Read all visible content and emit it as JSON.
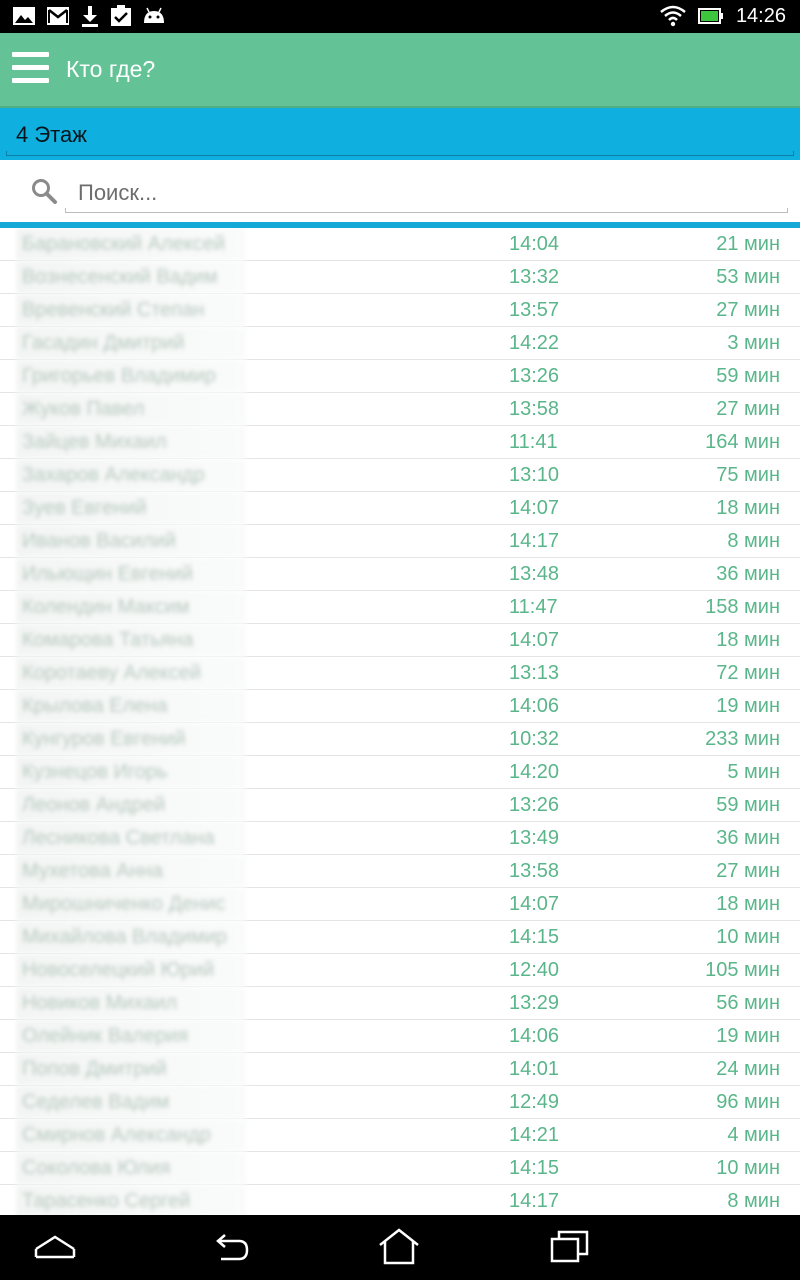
{
  "status_bar": {
    "time": "14:26"
  },
  "app_bar": {
    "title": "Кто где?"
  },
  "floor": {
    "label": "4 Этаж"
  },
  "search": {
    "placeholder": "Поиск..."
  },
  "rows": [
    {
      "name": "Барановский Алексей",
      "time": "14:04",
      "duration": "21 мин"
    },
    {
      "name": "Вознесенский Вадим",
      "time": "13:32",
      "duration": "53 мин"
    },
    {
      "name": "Вревенский Степан",
      "time": "13:57",
      "duration": "27 мин"
    },
    {
      "name": "Гасадин Дмитрий",
      "time": "14:22",
      "duration": "3 мин"
    },
    {
      "name": "Григорьев Владимир",
      "time": "13:26",
      "duration": "59 мин"
    },
    {
      "name": "Жуков Павел",
      "time": "13:58",
      "duration": "27 мин"
    },
    {
      "name": "Зайцев Михаил",
      "time": "11:41",
      "duration": "164 мин"
    },
    {
      "name": "Захаров Александр",
      "time": "13:10",
      "duration": "75 мин"
    },
    {
      "name": "Зуев Евгений",
      "time": "14:07",
      "duration": "18 мин"
    },
    {
      "name": "Иванов Василий",
      "time": "14:17",
      "duration": "8 мин"
    },
    {
      "name": "Ильющин Евгений",
      "time": "13:48",
      "duration": "36 мин"
    },
    {
      "name": "Колендин Максим",
      "time": "11:47",
      "duration": "158 мин"
    },
    {
      "name": "Комарова Татьяна",
      "time": "14:07",
      "duration": "18 мин"
    },
    {
      "name": "Коротаеву Алексей",
      "time": "13:13",
      "duration": "72 мин"
    },
    {
      "name": "Крылова Елена",
      "time": "14:06",
      "duration": "19 мин"
    },
    {
      "name": "Кунгуров Евгений",
      "time": "10:32",
      "duration": "233 мин"
    },
    {
      "name": "Кузнецов Игорь",
      "time": "14:20",
      "duration": "5 мин"
    },
    {
      "name": "Леонов Андрей",
      "time": "13:26",
      "duration": "59 мин"
    },
    {
      "name": "Лесникова Светлана",
      "time": "13:49",
      "duration": "36 мин"
    },
    {
      "name": "Мухетова Анна",
      "time": "13:58",
      "duration": "27 мин"
    },
    {
      "name": "Мирошниченко Денис",
      "time": "14:07",
      "duration": "18 мин"
    },
    {
      "name": "Михайлова Владимир",
      "time": "14:15",
      "duration": "10 мин"
    },
    {
      "name": "Новоселецкий Юрий",
      "time": "12:40",
      "duration": "105 мин"
    },
    {
      "name": "Новиков Михаил",
      "time": "13:29",
      "duration": "56 мин"
    },
    {
      "name": "Олейник Валерия",
      "time": "14:06",
      "duration": "19 мин"
    },
    {
      "name": "Попов Дмитрий",
      "time": "14:01",
      "duration": "24 мин"
    },
    {
      "name": "Седелев Вадим",
      "time": "12:49",
      "duration": "96 мин"
    },
    {
      "name": "Смирнов Александр",
      "time": "14:21",
      "duration": "4 мин"
    },
    {
      "name": "Соколова Юлия",
      "time": "14:15",
      "duration": "10 мин"
    },
    {
      "name": "Тарасенко Сергей",
      "time": "14:17",
      "duration": "8 мин"
    }
  ],
  "colors": {
    "app_bar": "#63c396",
    "floor_bar": "#0fb0e0",
    "accent_text": "#5ab68a"
  },
  "icons": {
    "status_left": [
      "image-icon",
      "gmail-icon",
      "download-icon",
      "clipboard-check-icon",
      "android-icon"
    ],
    "status_right": [
      "wifi-icon",
      "battery-icon"
    ],
    "nav": [
      "collapse-icon",
      "back-icon",
      "home-icon",
      "recents-icon"
    ]
  }
}
